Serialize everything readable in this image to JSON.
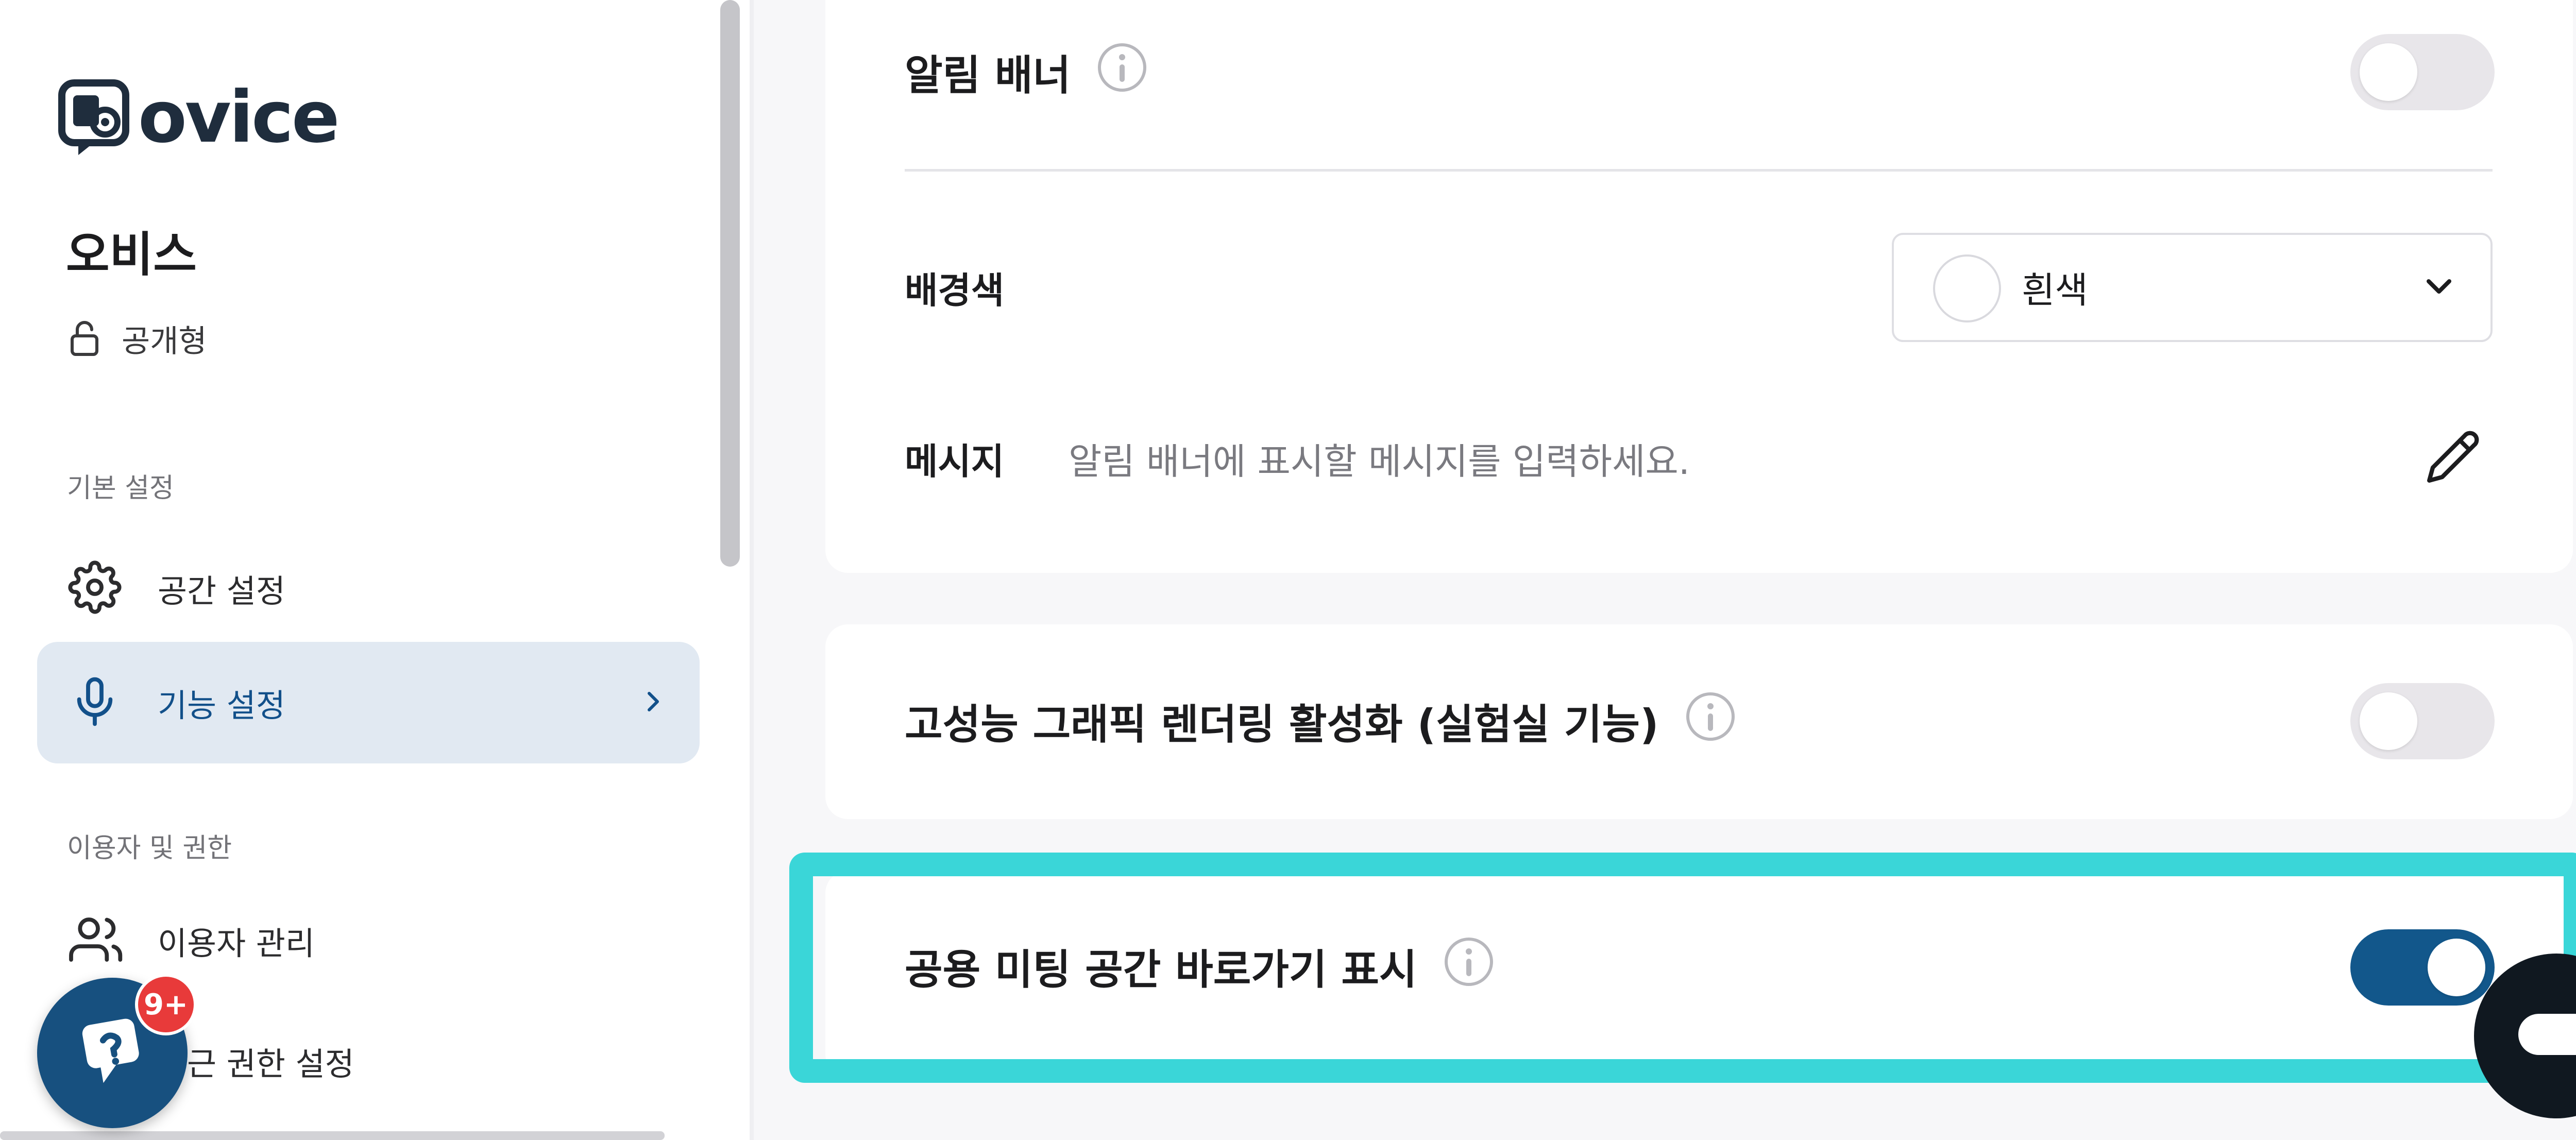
{
  "logo": {
    "text": "ovice"
  },
  "sidebar": {
    "space_name": "오비스",
    "space_type": "공개형",
    "sections": [
      {
        "label": "기본 설정",
        "items": [
          {
            "label": "공간 설정",
            "icon": "gear-icon",
            "active": false
          },
          {
            "label": "기능 설정",
            "icon": "microphone-icon",
            "active": true
          }
        ]
      },
      {
        "label": "이용자 및 권한",
        "items": [
          {
            "label": "이용자 관리",
            "icon": "users-icon",
            "active": false
          },
          {
            "label": "접근 권한 설정",
            "icon": "lock-icon",
            "active": false
          }
        ]
      }
    ]
  },
  "help_widget": {
    "badge": "9+"
  },
  "settings": {
    "notification_banner": {
      "title": "알림 배너",
      "enabled": false,
      "background_color_label": "배경색",
      "background_color_value": "흰색",
      "message_label": "메시지",
      "message_placeholder": "알림 배너에 표시할 메시지를 입력하세요."
    },
    "high_performance_rendering": {
      "title": "고성능 그래픽 렌더링 활성화 (실험실 기능)",
      "enabled": false
    },
    "public_meeting_shortcut": {
      "title": "공용 미팅 공간 바로가기 표시",
      "enabled": true
    }
  },
  "colors": {
    "accent": "#12578b",
    "highlight": "#3ad6d8",
    "active_nav_bg": "#e1e9f2",
    "badge": "#e83a3a"
  }
}
